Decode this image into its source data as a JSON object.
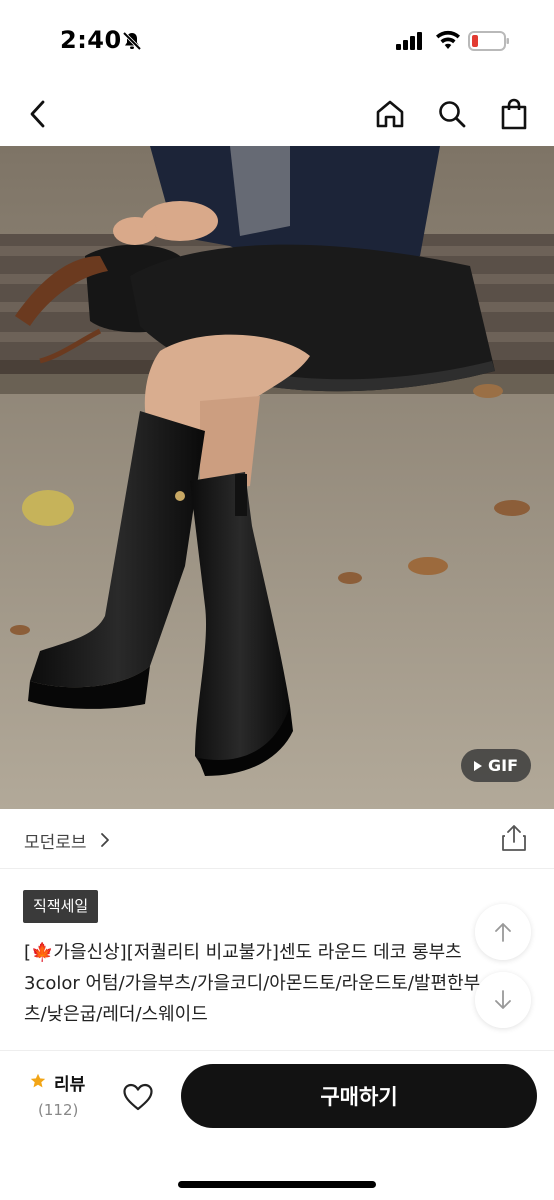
{
  "status_bar": {
    "time": "2:40",
    "icons": [
      "bell-slash-icon",
      "signal-icon",
      "wifi-icon",
      "battery-low-icon"
    ],
    "battery_color": "#e23b32"
  },
  "nav": {
    "back_icon": "chevron-left-icon",
    "home_icon": "home-icon",
    "search_icon": "search-icon",
    "cart_icon": "shopping-bag-icon"
  },
  "hero": {
    "media_type_label": "GIF",
    "play_icon": "play-icon"
  },
  "brand": {
    "name": "모던로브",
    "chevron_icon": "chevron-right-icon",
    "share_icon": "share-icon"
  },
  "product": {
    "badge": "직잭세일",
    "title_lines": [
      "[🍁가을신상][저퀄리티 비교불가]센도 라운드 데코 롱부츠",
      "3color 어텀/가을부츠/가을코디/아몬드토/라운드토/발편한부",
      "츠/낮은굽/레더/스웨이드"
    ]
  },
  "float_buttons": {
    "up_icon": "arrow-up-icon",
    "down_icon": "arrow-down-icon"
  },
  "bottom_bar": {
    "review_label": "리뷰",
    "review_count": "(112)",
    "star_icon": "star-icon",
    "star_color": "#f2a516",
    "wishlist_icon": "heart-outline-icon",
    "buy_label": "구매하기",
    "buy_color": "#121212"
  }
}
